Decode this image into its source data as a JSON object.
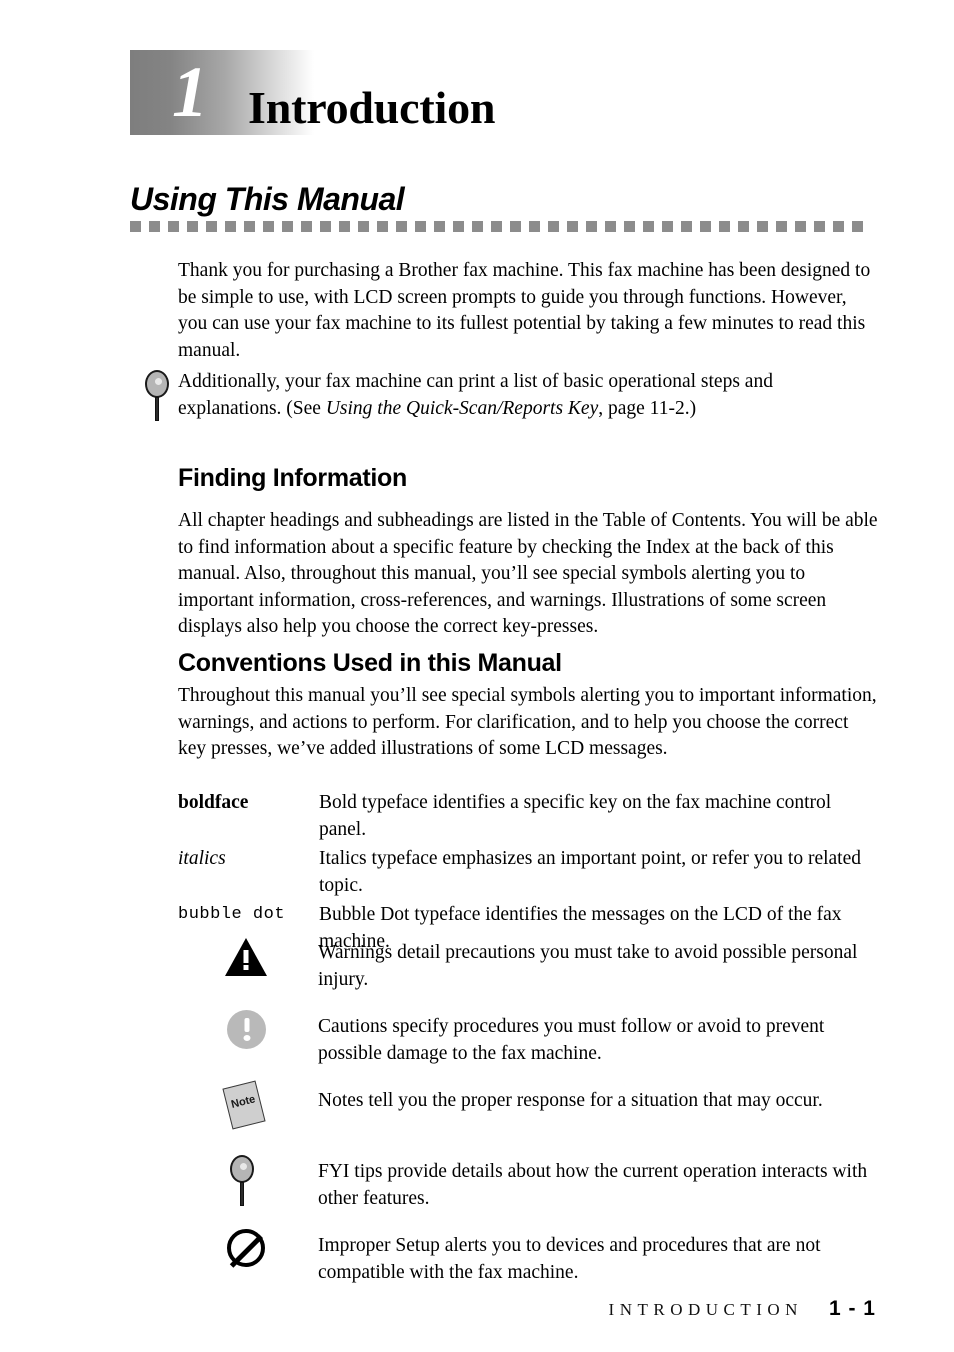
{
  "chapter": {
    "number": "1",
    "title": "Introduction"
  },
  "section": {
    "heading": "Using This Manual"
  },
  "intro_paragraph": "Thank you for purchasing a Brother fax machine. This fax machine has been designed to be simple to use, with LCD screen prompts to guide you through functions. However, you can use your fax machine to its fullest potential by taking a few minutes to read this manual.",
  "fyi_note": {
    "icon": "magnifier-fyi-icon",
    "text_before": "Additionally, your fax machine can print a list of basic operational steps and explanations. (See ",
    "italic_reference": "Using the Quick-Scan/Reports Key",
    "text_after": ", page 11-2.)"
  },
  "finding_information": {
    "heading": "Finding Information",
    "text": "All chapter headings and subheadings are listed in the Table of Contents. You will be able to find information about a specific feature by checking the Index at the back of this manual. Also, throughout this manual, you’ll see special symbols alerting you to important information, cross-references, and warnings. Illustrations of some screen displays also help you choose the correct key-presses."
  },
  "conventions": {
    "heading": "Conventions Used in this Manual",
    "text": "Throughout this manual you’ll see special symbols alerting you to important information, warnings, and actions to perform. For clarification, and to help you choose the correct key presses, we’ve added illustrations of some LCD messages.",
    "typefaces": [
      {
        "term": "boldface",
        "style": "bold",
        "description": "Bold typeface identifies a specific key on the fax machine control panel."
      },
      {
        "term": "italics",
        "style": "italic",
        "description": "Italics typeface emphasizes an important point, or refer you to related topic."
      },
      {
        "term": "bubble dot",
        "style": "dotfont",
        "description": "Bubble Dot typeface identifies the messages on the LCD of the fax machine."
      }
    ],
    "symbols": [
      {
        "icon": "warning-triangle-icon",
        "description": "Warnings detail precautions you must take to avoid possible personal injury."
      },
      {
        "icon": "caution-exclamation-icon",
        "description": "Cautions specify procedures you must follow or avoid to prevent possible damage to the fax machine."
      },
      {
        "icon": "note-sticky-icon",
        "icon_label": "Note",
        "description": "Notes tell you the proper response for a situation that may occur."
      },
      {
        "icon": "fyi-magnifier-icon",
        "description": "FYI tips provide details about how the current operation interacts with other features."
      },
      {
        "icon": "improper-setup-prohibited-icon",
        "description": "Improper Setup alerts you to devices and procedures that are not compatible with the fax machine."
      }
    ]
  },
  "footer": {
    "chapter_label": "INTRODUCTION",
    "page_number": "1 - 1"
  },
  "colors": {
    "rule_gray": "#8c8c8c",
    "header_gradient_start": "#7e7e7e",
    "header_gradient_end": "#ffffff",
    "caution_gray": "#b9b9b9",
    "note_gray": "#cfcfcf"
  }
}
